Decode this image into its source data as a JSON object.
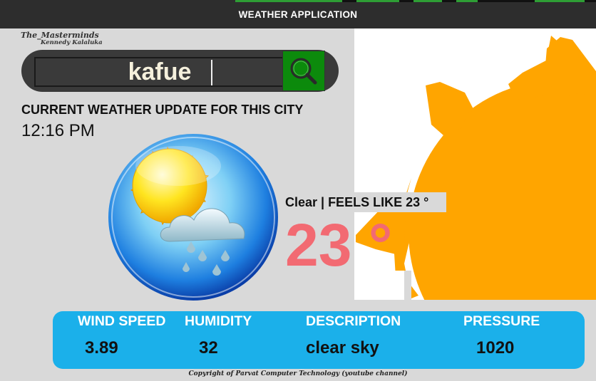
{
  "window": {
    "title": "WEATHER APPLICATION"
  },
  "brand": {
    "line1": "The_Masterminds",
    "line2": "Kennedy Kalaluka"
  },
  "search": {
    "value": "kafue",
    "button_icon": "search-icon"
  },
  "heading": "CURRENT WEATHER UPDATE FOR THIS CITY",
  "time": "12:16 PM",
  "weather": {
    "condition_icon": "sun-cloud-rain-icon",
    "feels_text": "Clear | FEELS LIKE 23 °",
    "temperature": "23 °"
  },
  "decoration": {
    "icon": "sun-icon"
  },
  "info": {
    "wind_label": "WIND SPEED",
    "wind_value": "3.89",
    "humidity_label": "HUMIDITY",
    "humidity_value": "32",
    "description_label": "DESCRIPTION",
    "description_value": "clear sky",
    "pressure_label": "PRESSURE",
    "pressure_value": "1020"
  },
  "footer": "Copyright of Parvat Computer Technology (youtube channel)",
  "colors": {
    "accent_blue": "#1bb0ea",
    "temperature": "#f26a72",
    "search_button": "#0c8a0c",
    "sun": "#ffa500"
  }
}
